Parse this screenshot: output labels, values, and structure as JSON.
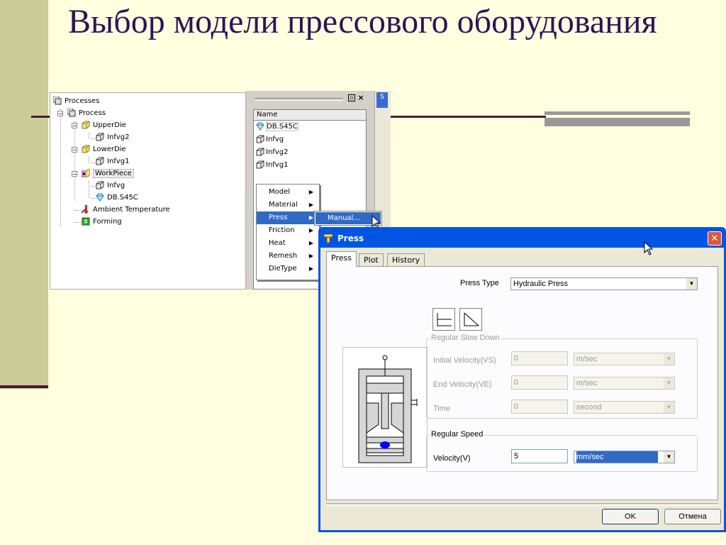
{
  "slide": {
    "title": "Выбор модели прессового оборудования"
  },
  "tree": {
    "items": [
      {
        "label": "Processes",
        "icon": "processes-icon"
      },
      {
        "label": "Process",
        "icon": "process-icon"
      },
      {
        "label": "UpperDie",
        "icon": "die-icon"
      },
      {
        "label": "Infvg2",
        "icon": "mesh-icon"
      },
      {
        "label": "LowerDie",
        "icon": "die-icon"
      },
      {
        "label": "Infvg1",
        "icon": "mesh-icon"
      },
      {
        "label": "WorkPiece",
        "icon": "workpiece-icon"
      },
      {
        "label": "Infvg",
        "icon": "mesh-icon"
      },
      {
        "label": "DB.S45C",
        "icon": "material-icon"
      },
      {
        "label": "Ambient Temperature",
        "icon": "thermometer-icon"
      },
      {
        "label": "Forming",
        "icon": "forming-icon"
      }
    ]
  },
  "right_list": {
    "header": "Name",
    "items": [
      "DB.S45C",
      "Infvg",
      "Infvg2",
      "Infvg1"
    ],
    "side_tab": "S"
  },
  "context_menu": {
    "items": [
      "Model",
      "Material",
      "Press",
      "Friction",
      "Heat",
      "Remesh",
      "DieType"
    ],
    "active": "Press",
    "submenu_item": "Manual..."
  },
  "dialog": {
    "title": "Press",
    "tabs": [
      "Press",
      "Plot",
      "History"
    ],
    "press_type_label": "Press Type",
    "press_type_value": "Hydraulic Press",
    "slow_down": {
      "title": "Regular Slow Down",
      "initial_velocity_label": "Initial Velocity(VS)",
      "initial_velocity_value": "0",
      "initial_velocity_unit": "m/sec",
      "end_velocity_label": "End Velocity(VE)",
      "end_velocity_value": "0",
      "end_velocity_unit": "m/sec",
      "time_label": "Time",
      "time_value": "0",
      "time_unit": "second"
    },
    "speed": {
      "title": "Regular Speed",
      "velocity_label": "Velocity(V)",
      "velocity_value": "5",
      "velocity_unit": "mm/sec"
    },
    "ok_label": "OK",
    "cancel_label": "Отмена"
  },
  "colors": {
    "title_text": "#2c1458",
    "background": "#ffffe0",
    "accent_bar": "#cccc99",
    "xp_titlebar": "#0055e5",
    "selection": "#316ac5"
  }
}
